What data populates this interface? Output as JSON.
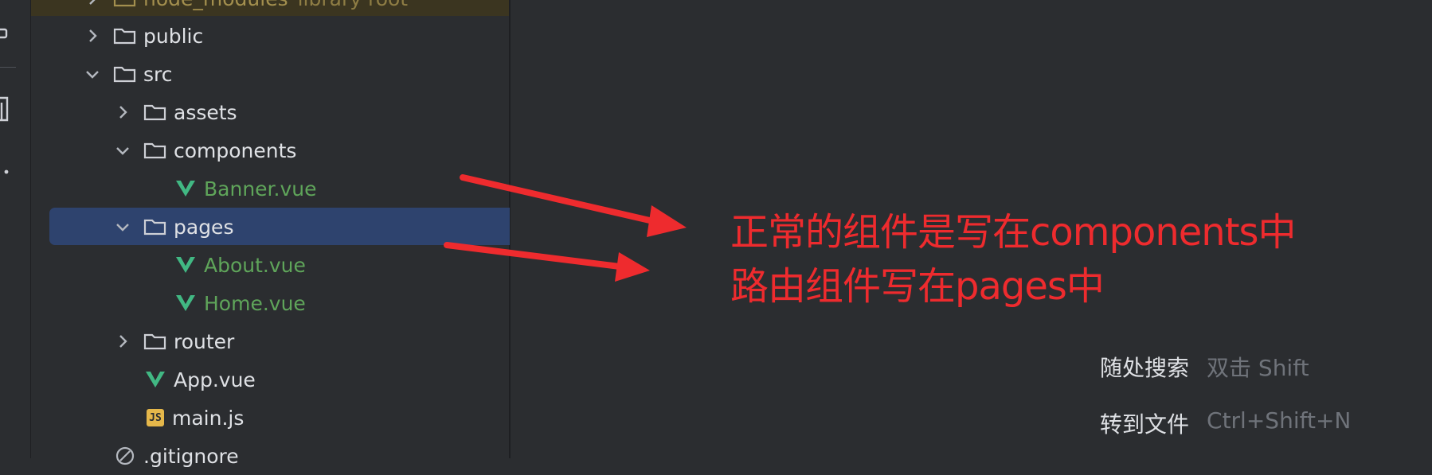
{
  "tree": {
    "items": [
      {
        "label": "node_modules",
        "extra": "library root",
        "type": "folder",
        "expanded": false
      },
      {
        "label": "public",
        "type": "folder",
        "expanded": false
      },
      {
        "label": "src",
        "type": "folder",
        "expanded": true
      },
      {
        "label": "assets",
        "type": "folder",
        "expanded": false
      },
      {
        "label": "components",
        "type": "folder",
        "expanded": true
      },
      {
        "label": "Banner.vue",
        "type": "vue"
      },
      {
        "label": "pages",
        "type": "folder",
        "expanded": true,
        "selected": true
      },
      {
        "label": "About.vue",
        "type": "vue"
      },
      {
        "label": "Home.vue",
        "type": "vue"
      },
      {
        "label": "router",
        "type": "folder",
        "expanded": false
      },
      {
        "label": "App.vue",
        "type": "vue"
      },
      {
        "label": "main.js",
        "type": "js",
        "icon_text": "JS"
      },
      {
        "label": ".gitignore",
        "type": "ignore"
      }
    ]
  },
  "annotation": {
    "line1": "正常的组件是写在components中",
    "line2": "路由组件写在pages中",
    "color": "#ee2b2e"
  },
  "hints": [
    {
      "label": "随处搜索",
      "key": "双击 Shift"
    },
    {
      "label": "转到文件",
      "key": "Ctrl+Shift+N"
    }
  ],
  "colors": {
    "selection": "#2e436e",
    "vue_file": "#5fa55a",
    "vue_icon": "#41b883",
    "background": "#2b2d30"
  },
  "icons": [
    "chevron-right-icon",
    "chevron-down-icon",
    "folder-icon",
    "vue-icon",
    "js-icon",
    "ignore-icon"
  ]
}
